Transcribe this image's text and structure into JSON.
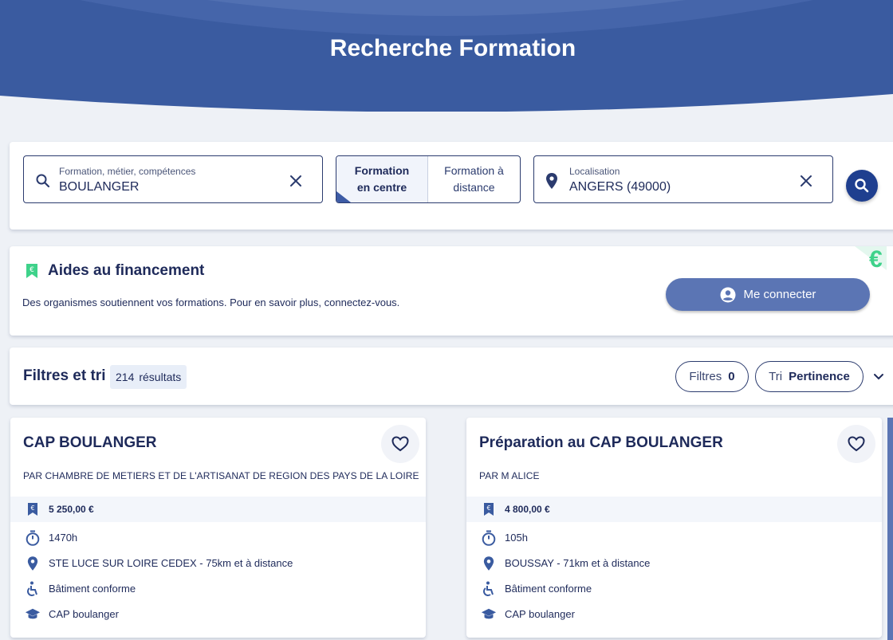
{
  "header": {
    "title": "Recherche Formation"
  },
  "search": {
    "query_label": "Formation, métier, compétences",
    "query_value": "BOULANGER",
    "mode_active": "Formation en centre",
    "mode_inactive": "Formation à distance",
    "location_label": "Localisation",
    "location_value": "ANGERS (49000)"
  },
  "financing": {
    "title": "Aides au financement",
    "description": "Des organismes soutiennent vos formations. Pour en savoir plus, connectez-vous.",
    "connect_label": "Me connecter",
    "decor_symbol": "€"
  },
  "filters": {
    "title": "Filtres et tri",
    "results_count": "214",
    "results_label": "résultats",
    "filters_label": "Filtres",
    "filters_count": "0",
    "sort_label": "Tri",
    "sort_value": "Pertinence"
  },
  "results": [
    {
      "title": "CAP BOULANGER",
      "organization": "PAR CHAMBRE DE METIERS ET DE L'ARTISANAT DE REGION DES PAYS DE LA LOIRE",
      "price": "5 250,00 €",
      "duration": "1470h",
      "location": "STE LUCE SUR LOIRE CEDEX - 75km et à distance",
      "accessibility": "Bâtiment conforme",
      "diploma": "CAP boulanger"
    },
    {
      "title": "Préparation au CAP BOULANGER",
      "organization": "PAR M ALICE",
      "price": "4 800,00 €",
      "duration": "105h",
      "location": "BOUSSAY - 71km et à distance",
      "accessibility": "Bâtiment conforme",
      "diploma": "CAP boulanger"
    }
  ],
  "colors": {
    "primary": "#3a5ba0",
    "dark_navy": "#1e2a5a",
    "button_blue": "#5b75b4",
    "euro_green": "#3ed28a"
  }
}
